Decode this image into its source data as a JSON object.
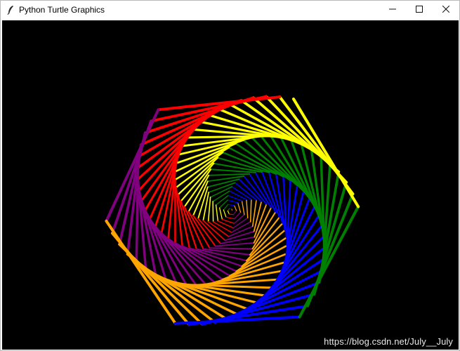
{
  "window": {
    "title": "Python Turtle Graphics",
    "app_icon": "feather-icon",
    "controls": {
      "minimize_icon": "minimize-icon",
      "maximize_icon": "maximize-icon",
      "close_icon": "close-icon"
    }
  },
  "canvas": {
    "background": "#000000",
    "drawing": "hexagonal-spiral",
    "sides": 6,
    "pen_colors": [
      "#ff0000",
      "#800080",
      "#ffa500",
      "#0000ff",
      "#008000",
      "#ffff00"
    ]
  },
  "watermark": {
    "text": "https://blog.csdn.net/July__July"
  }
}
